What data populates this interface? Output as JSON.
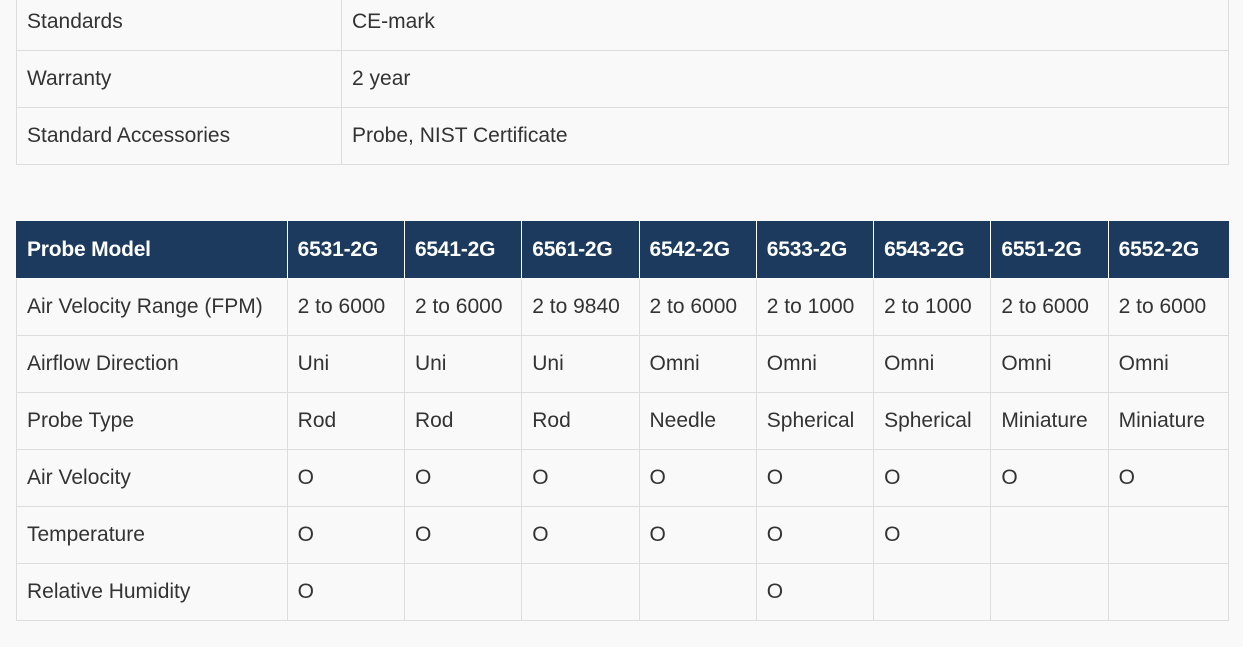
{
  "specs": [
    {
      "label": "Standards",
      "value": "CE-mark"
    },
    {
      "label": "Warranty",
      "value": "2 year"
    },
    {
      "label": "Standard Accessories",
      "value": "Probe, NIST Certificate"
    }
  ],
  "models_table": {
    "header_label": "Probe Model",
    "models": [
      "6531-2G",
      "6541-2G",
      "6561-2G",
      "6542-2G",
      "6533-2G",
      "6543-2G",
      "6551-2G",
      "6552-2G"
    ],
    "rows": [
      {
        "label": "Air Velocity Range (FPM)",
        "cells": [
          "2 to 6000",
          "2 to 6000",
          "2 to 9840",
          "2 to 6000",
          "2 to 1000",
          "2 to 1000",
          "2 to 6000",
          "2 to 6000"
        ]
      },
      {
        "label": "Airflow Direction",
        "cells": [
          "Uni",
          "Uni",
          "Uni",
          "Omni",
          "Omni",
          "Omni",
          "Omni",
          "Omni"
        ]
      },
      {
        "label": "Probe Type",
        "cells": [
          "Rod",
          "Rod",
          "Rod",
          "Needle",
          "Spherical",
          "Spherical",
          "Miniature",
          "Miniature"
        ]
      },
      {
        "label": "Air Velocity",
        "cells": [
          "O",
          "O",
          "O",
          "O",
          "O",
          "O",
          "O",
          "O"
        ]
      },
      {
        "label": "Temperature",
        "cells": [
          "O",
          "O",
          "O",
          "O",
          "O",
          "O",
          "",
          ""
        ]
      },
      {
        "label": "Relative Humidity",
        "cells": [
          "O",
          "",
          "",
          "",
          "O",
          "",
          "",
          ""
        ]
      }
    ]
  },
  "colors": {
    "header_bg": "#1b3a5e",
    "border": "#dddddd",
    "page_bg": "#f9f9f9"
  }
}
